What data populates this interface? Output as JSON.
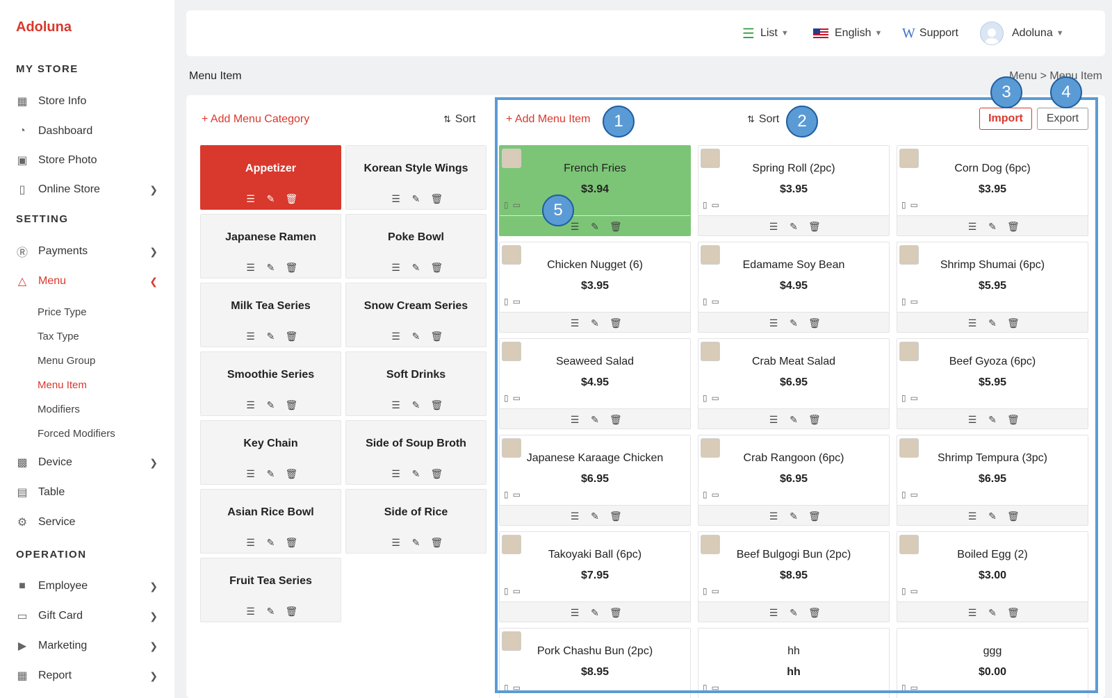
{
  "app": {
    "name": "Adoluna"
  },
  "sidebar": {
    "sections": {
      "my_store": "MY STORE",
      "setting": "SETTING",
      "operation": "OPERATION"
    },
    "items": {
      "store_info": "Store Info",
      "dashboard": "Dashboard",
      "store_photo": "Store Photo",
      "online_store": "Online Store",
      "payments": "Payments",
      "menu": "Menu",
      "device": "Device",
      "table": "Table",
      "service": "Service",
      "employee": "Employee",
      "gift_card": "Gift Card",
      "marketing": "Marketing",
      "report": "Report"
    },
    "menu_sub": [
      "Price Type",
      "Tax Type",
      "Menu Group",
      "Menu Item",
      "Modifiers",
      "Forced Modifiers"
    ]
  },
  "topbar": {
    "view": "List",
    "language": "English",
    "support": "Support",
    "user": "Adoluna"
  },
  "page": {
    "title": "Menu Item",
    "breadcrumb": "Menu  >  Menu Item"
  },
  "categories": {
    "add_label": "+ Add Menu Category",
    "sort_label": "Sort",
    "items": [
      "Appetizer",
      "Korean Style Wings",
      "Japanese Ramen",
      "Poke Bowl",
      "Milk Tea Series",
      "Snow Cream Series",
      "Smoothie Series",
      "Soft Drinks",
      "Key Chain",
      "Side of Soup Broth",
      "Asian Rice Bowl",
      "Side of Rice",
      "Fruit Tea Series"
    ]
  },
  "items": {
    "add_label": "+ Add Menu Item",
    "sort_label": "Sort",
    "import_label": "Import",
    "export_label": "Export",
    "list": [
      {
        "name": "French Fries",
        "price": "$3.94"
      },
      {
        "name": "Spring Roll (2pc)",
        "price": "$3.95"
      },
      {
        "name": "Corn Dog (6pc)",
        "price": "$3.95"
      },
      {
        "name": "Chicken Nugget (6)",
        "price": "$3.95"
      },
      {
        "name": "Edamame Soy Bean",
        "price": "$4.95"
      },
      {
        "name": "Shrimp Shumai (6pc)",
        "price": "$5.95"
      },
      {
        "name": "Seaweed Salad",
        "price": "$4.95"
      },
      {
        "name": "Crab Meat Salad",
        "price": "$6.95"
      },
      {
        "name": "Beef Gyoza (6pc)",
        "price": "$5.95"
      },
      {
        "name": "Japanese Karaage Chicken",
        "price": "$6.95"
      },
      {
        "name": "Crab Rangoon (6pc)",
        "price": "$6.95"
      },
      {
        "name": "Shrimp Tempura (3pc)",
        "price": "$6.95"
      },
      {
        "name": "Takoyaki Ball (6pc)",
        "price": "$7.95"
      },
      {
        "name": "Beef Bulgogi Bun (2pc)",
        "price": "$8.95"
      },
      {
        "name": "Boiled Egg (2)",
        "price": "$3.00"
      },
      {
        "name": "Pork Chashu Bun (2pc)",
        "price": "$8.95"
      },
      {
        "name": "hh",
        "price": "hh"
      },
      {
        "name": "ggg",
        "price": "$0.00"
      }
    ]
  },
  "annotations": [
    "1",
    "2",
    "3",
    "4",
    "5"
  ],
  "colors": {
    "accent": "#d9382c",
    "selected_item": "#7cc576",
    "annotation": "#5b9bd5"
  }
}
